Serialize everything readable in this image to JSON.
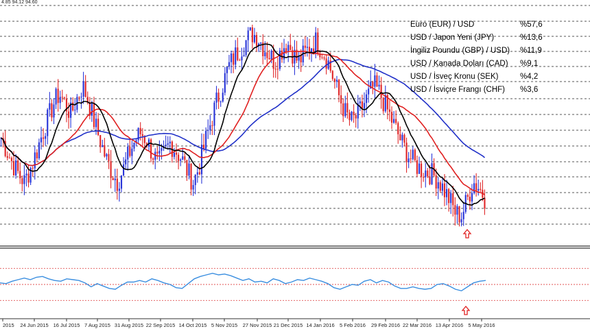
{
  "header": {
    "ohlc_text": "4.85 94.12 94.60"
  },
  "legend": [
    {
      "label": "Euro (EUR) / USD",
      "pct": "%57,6"
    },
    {
      "label": "USD / Japon Yeni (JPY)",
      "pct": "%13,6"
    },
    {
      "label": "İngiliz Poundu (GBP) / USD)",
      "pct": "%11,9"
    },
    {
      "label": "USD / Kanada Doları (CAD)",
      "pct": "%9,1"
    },
    {
      "label": "USD / İsveç Kronu (SEK)",
      "pct": "%4,2"
    },
    {
      "label": "USD / İsviçre Frangı (CHF)",
      "pct": "%3,6"
    }
  ],
  "colors": {
    "up_candle": "#2a36d8",
    "down_candle": "#e0282a",
    "ma_fast": "#000000",
    "ma_mid": "#e02020",
    "ma_slow": "#2030c8",
    "oscillator": "#3a8ee0",
    "arrow": "#e02020",
    "grid": "#555555",
    "osc_levels": "#e05050"
  },
  "icons": {
    "arrow_low_price": "arrow-up-icon",
    "arrow_low_osc": "arrow-up-icon"
  },
  "chart_data": {
    "type": "candlestick",
    "series": [
      {
        "name": "Euro (EUR) / USD",
        "weight_pct": 57.6
      },
      {
        "name": "USD / Japon Yeni (JPY)",
        "weight_pct": 13.6
      },
      {
        "name": "İngiliz Poundu (GBP) / USD)",
        "weight_pct": 11.9
      },
      {
        "name": "USD / Kanada Doları (CAD)",
        "weight_pct": 9.1
      },
      {
        "name": "USD / İsveç Kronu (SEK)",
        "weight_pct": 4.2
      },
      {
        "name": "USD / İsviçre Frangı (CHF)",
        "weight_pct": 3.6
      }
    ],
    "x_tick_labels": [
      "2015",
      "24 Jun 2015",
      "16 Jul 2015",
      "7 Aug 2015",
      "31 Aug 2015",
      "22 Sep 2015",
      "14 Oct 2015",
      "5 Nov 2015",
      "27 Nov 2015",
      "21 Dec 2015",
      "14 Jan 2016",
      "5 Feb 2016",
      "29 Feb 2016",
      "22 Mar 2016",
      "13 Apr 2016",
      "5 May 2016"
    ],
    "price_close": [
      95.9,
      95.4,
      94.9,
      94.5,
      94.2,
      94.7,
      95.3,
      96.0,
      96.6,
      97.2,
      97.6,
      97.2,
      96.8,
      97.4,
      97.9,
      97.3,
      96.5,
      95.8,
      95.1,
      94.6,
      94.2,
      94.7,
      95.3,
      95.8,
      96.1,
      95.8,
      95.3,
      94.9,
      95.3,
      95.7,
      95.4,
      95.1,
      94.6,
      94.2,
      94.8,
      95.7,
      96.5,
      97.3,
      97.9,
      98.6,
      99.0,
      99.3,
      99.6,
      99.9,
      99.8,
      99.4,
      99.1,
      98.8,
      99.2,
      99.6,
      99.2,
      98.8,
      99.1,
      99.4,
      99.6,
      99.3,
      98.9,
      98.2,
      97.5,
      96.9,
      96.5,
      96.7,
      97.1,
      97.5,
      97.9,
      97.6,
      97.1,
      96.6,
      96.1,
      95.6,
      95.2,
      94.9,
      94.7,
      94.6,
      94.5,
      94.3,
      93.9,
      93.5,
      93.0,
      92.9,
      93.5,
      94.2,
      94.0,
      93.6
    ],
    "oscillator": [
      52,
      51,
      54,
      56,
      58,
      56,
      59,
      60,
      57,
      55,
      54,
      57,
      56,
      55,
      52,
      47,
      51,
      48,
      45,
      44,
      49,
      53,
      53,
      55,
      53,
      57,
      55,
      52,
      50,
      46,
      45,
      51,
      57,
      60,
      62,
      64,
      62,
      63,
      61,
      58,
      55,
      57,
      53,
      54,
      52,
      57,
      55,
      51,
      53,
      56,
      55,
      58,
      56,
      54,
      51,
      46,
      44,
      47,
      50,
      49,
      54,
      56,
      52,
      55,
      53,
      48,
      45,
      45,
      47,
      45,
      44,
      45,
      50,
      51,
      48,
      44,
      42,
      47,
      52,
      54,
      55
    ],
    "moving_averages": [
      "ma_fast",
      "ma_mid",
      "ma_slow"
    ],
    "oscillator_levels": [
      70,
      50,
      30
    ],
    "grid": true,
    "legend_position": "top-right"
  }
}
